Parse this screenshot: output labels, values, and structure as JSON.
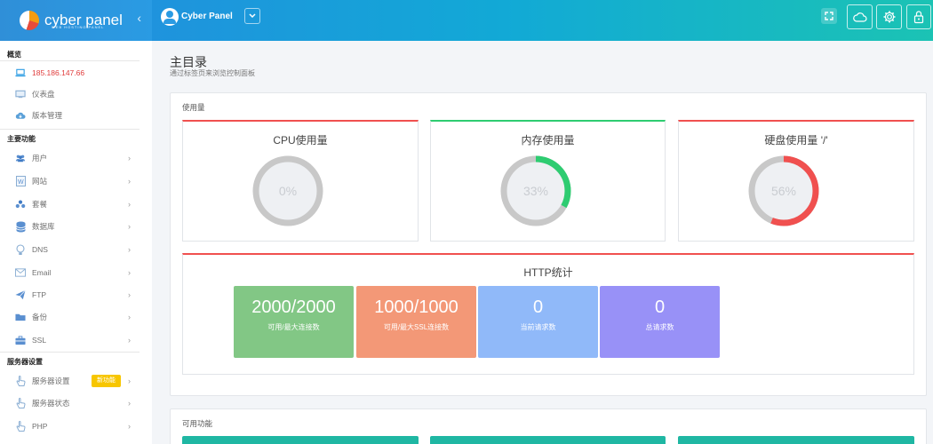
{
  "brand": {
    "name": "cyber panel",
    "tagline": "WEB HOSTING PANEL"
  },
  "topbar": {
    "user_name": "Cyber Panel"
  },
  "sidebar": {
    "sections": [
      {
        "title": "概览"
      },
      {
        "title": "主要功能"
      },
      {
        "title": "服务器设置"
      }
    ],
    "items": [
      {
        "label": "185.186.147.66",
        "icon": "laptop-icon"
      },
      {
        "label": "仪表盘",
        "icon": "monitor-icon"
      },
      {
        "label": "版本管理",
        "icon": "cloud-download-icon"
      },
      {
        "label": "用户",
        "icon": "users-icon"
      },
      {
        "label": "网站",
        "icon": "wordpress-icon"
      },
      {
        "label": "套餐",
        "icon": "cubes-icon"
      },
      {
        "label": "数据库",
        "icon": "database-icon"
      },
      {
        "label": "DNS",
        "icon": "bulb-icon"
      },
      {
        "label": "Email",
        "icon": "envelope-icon"
      },
      {
        "label": "FTP",
        "icon": "paper-plane-icon"
      },
      {
        "label": "备份",
        "icon": "folder-icon"
      },
      {
        "label": "SSL",
        "icon": "briefcase-icon"
      },
      {
        "label": "服务器设置",
        "icon": "hand-pointer-icon",
        "badge": "新功能"
      },
      {
        "label": "服务器状态",
        "icon": "hand-pointer-icon"
      },
      {
        "label": "PHP",
        "icon": "hand-pointer-icon"
      }
    ]
  },
  "main": {
    "title": "主目录",
    "subtitle": "通过标签页来浏览控制面板",
    "usage_panel_title": "使用量",
    "features_panel_title": "可用功能",
    "gauges": [
      {
        "title": "CPU使用量",
        "percent": 0,
        "label": "0%",
        "color": "#2ecc71"
      },
      {
        "title": "内存使用量",
        "percent": 33,
        "label": "33%",
        "color": "#2ecc71"
      },
      {
        "title": "硬盘使用量 '/'",
        "percent": 56,
        "label": "56%",
        "color": "#f0504f"
      }
    ],
    "http": {
      "title": "HTTP统计",
      "stats": [
        {
          "value": "2000/2000",
          "label": "可用/最大连接数",
          "color": "#82c785"
        },
        {
          "value": "1000/1000",
          "label": "可用/最大SSL连接数",
          "color": "#f39877"
        },
        {
          "value": "0",
          "label": "当前请求数",
          "color": "#90b9f9"
        },
        {
          "value": "0",
          "label": "总请求数",
          "color": "#9891f7"
        }
      ]
    }
  },
  "colors": {
    "card_top_red": "#f0504f",
    "card_top_green": "#2ecc71",
    "gauge_track": "#c8c8c8",
    "teal": "#1fb7a3"
  }
}
